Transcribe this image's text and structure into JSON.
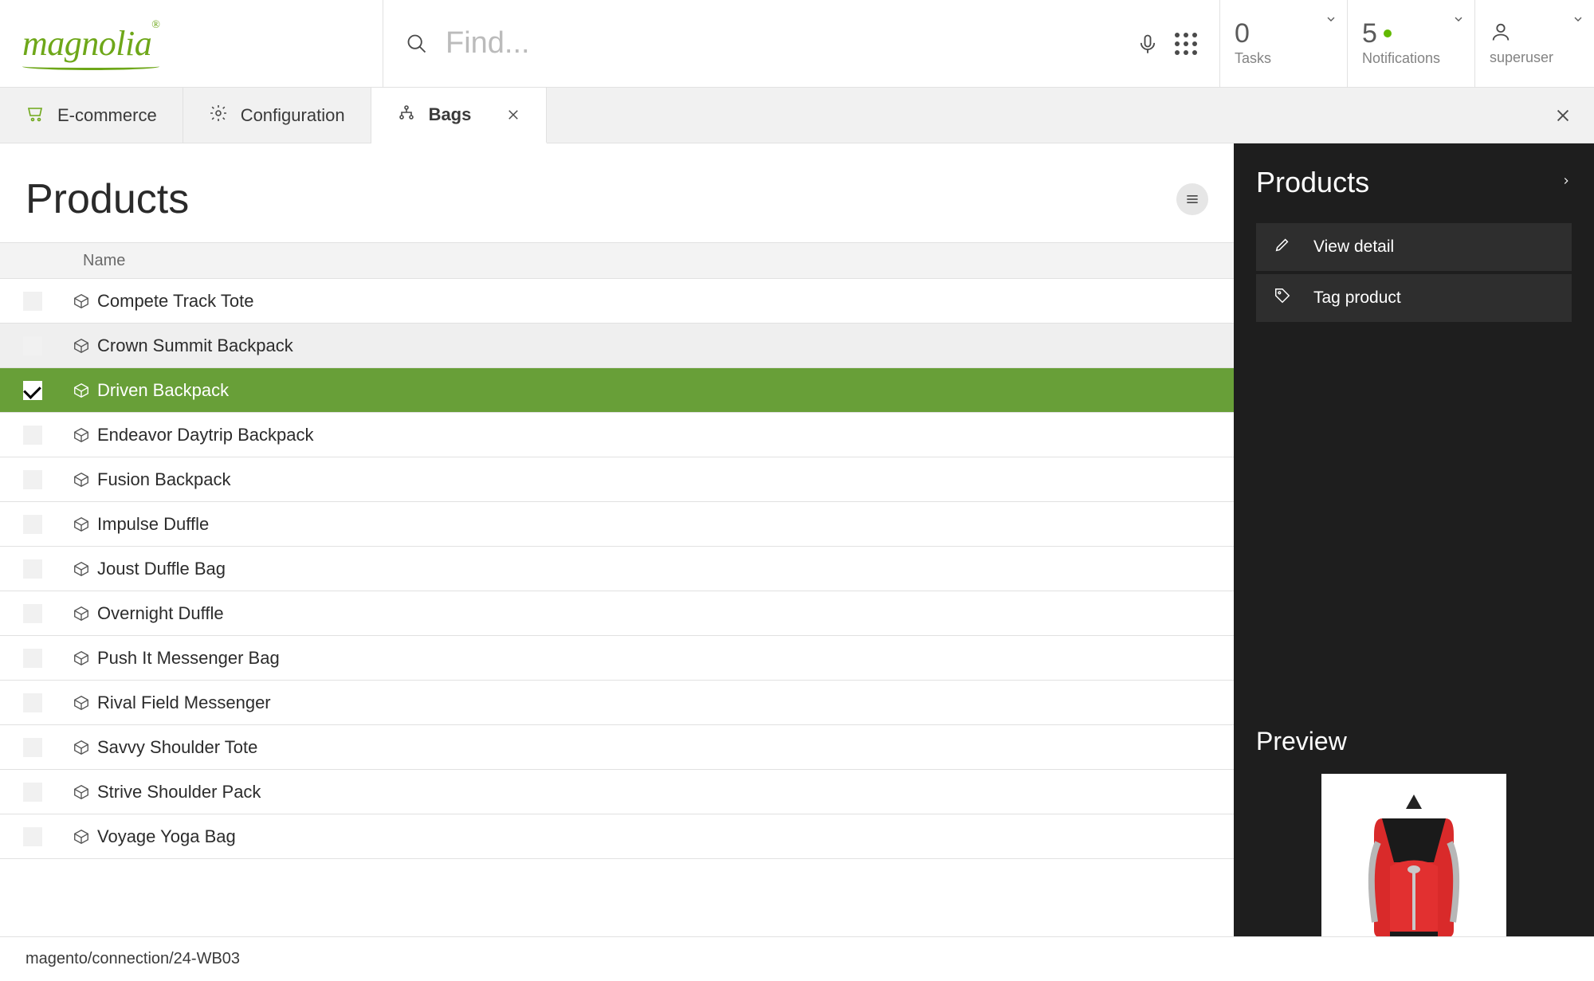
{
  "header": {
    "logo_text": "magnolia",
    "search_placeholder": "Find...",
    "tasks": {
      "count": "0",
      "label": "Tasks"
    },
    "notifications": {
      "count": "5",
      "label": "Notifications"
    },
    "user": {
      "name": "superuser"
    }
  },
  "tabs": [
    {
      "label": "E-commerce",
      "icon": "cart-icon",
      "active": false,
      "closable": false
    },
    {
      "label": "Configuration",
      "icon": "gear-icon",
      "active": false,
      "closable": false
    },
    {
      "label": "Bags",
      "icon": "node-icon",
      "active": true,
      "closable": true
    }
  ],
  "page": {
    "title": "Products",
    "column_header": "Name"
  },
  "rows": [
    {
      "name": "Compete Track Tote",
      "selected": false,
      "hover": false
    },
    {
      "name": "Crown Summit Backpack",
      "selected": false,
      "hover": true
    },
    {
      "name": "Driven Backpack",
      "selected": true,
      "hover": false
    },
    {
      "name": "Endeavor Daytrip Backpack",
      "selected": false,
      "hover": false
    },
    {
      "name": "Fusion Backpack",
      "selected": false,
      "hover": false
    },
    {
      "name": "Impulse Duffle",
      "selected": false,
      "hover": false
    },
    {
      "name": "Joust Duffle Bag",
      "selected": false,
      "hover": false
    },
    {
      "name": "Overnight Duffle",
      "selected": false,
      "hover": false
    },
    {
      "name": "Push It Messenger Bag",
      "selected": false,
      "hover": false
    },
    {
      "name": "Rival Field Messenger",
      "selected": false,
      "hover": false
    },
    {
      "name": "Savvy Shoulder Tote",
      "selected": false,
      "hover": false
    },
    {
      "name": "Strive Shoulder Pack",
      "selected": false,
      "hover": false
    },
    {
      "name": "Voyage Yoga Bag",
      "selected": false,
      "hover": false
    }
  ],
  "panel": {
    "title": "Products",
    "actions": [
      {
        "label": "View detail",
        "icon": "pencil-icon"
      },
      {
        "label": "Tag product",
        "icon": "tag-icon"
      }
    ],
    "preview_title": "Preview"
  },
  "statusbar": "magento/connection/24-WB03"
}
